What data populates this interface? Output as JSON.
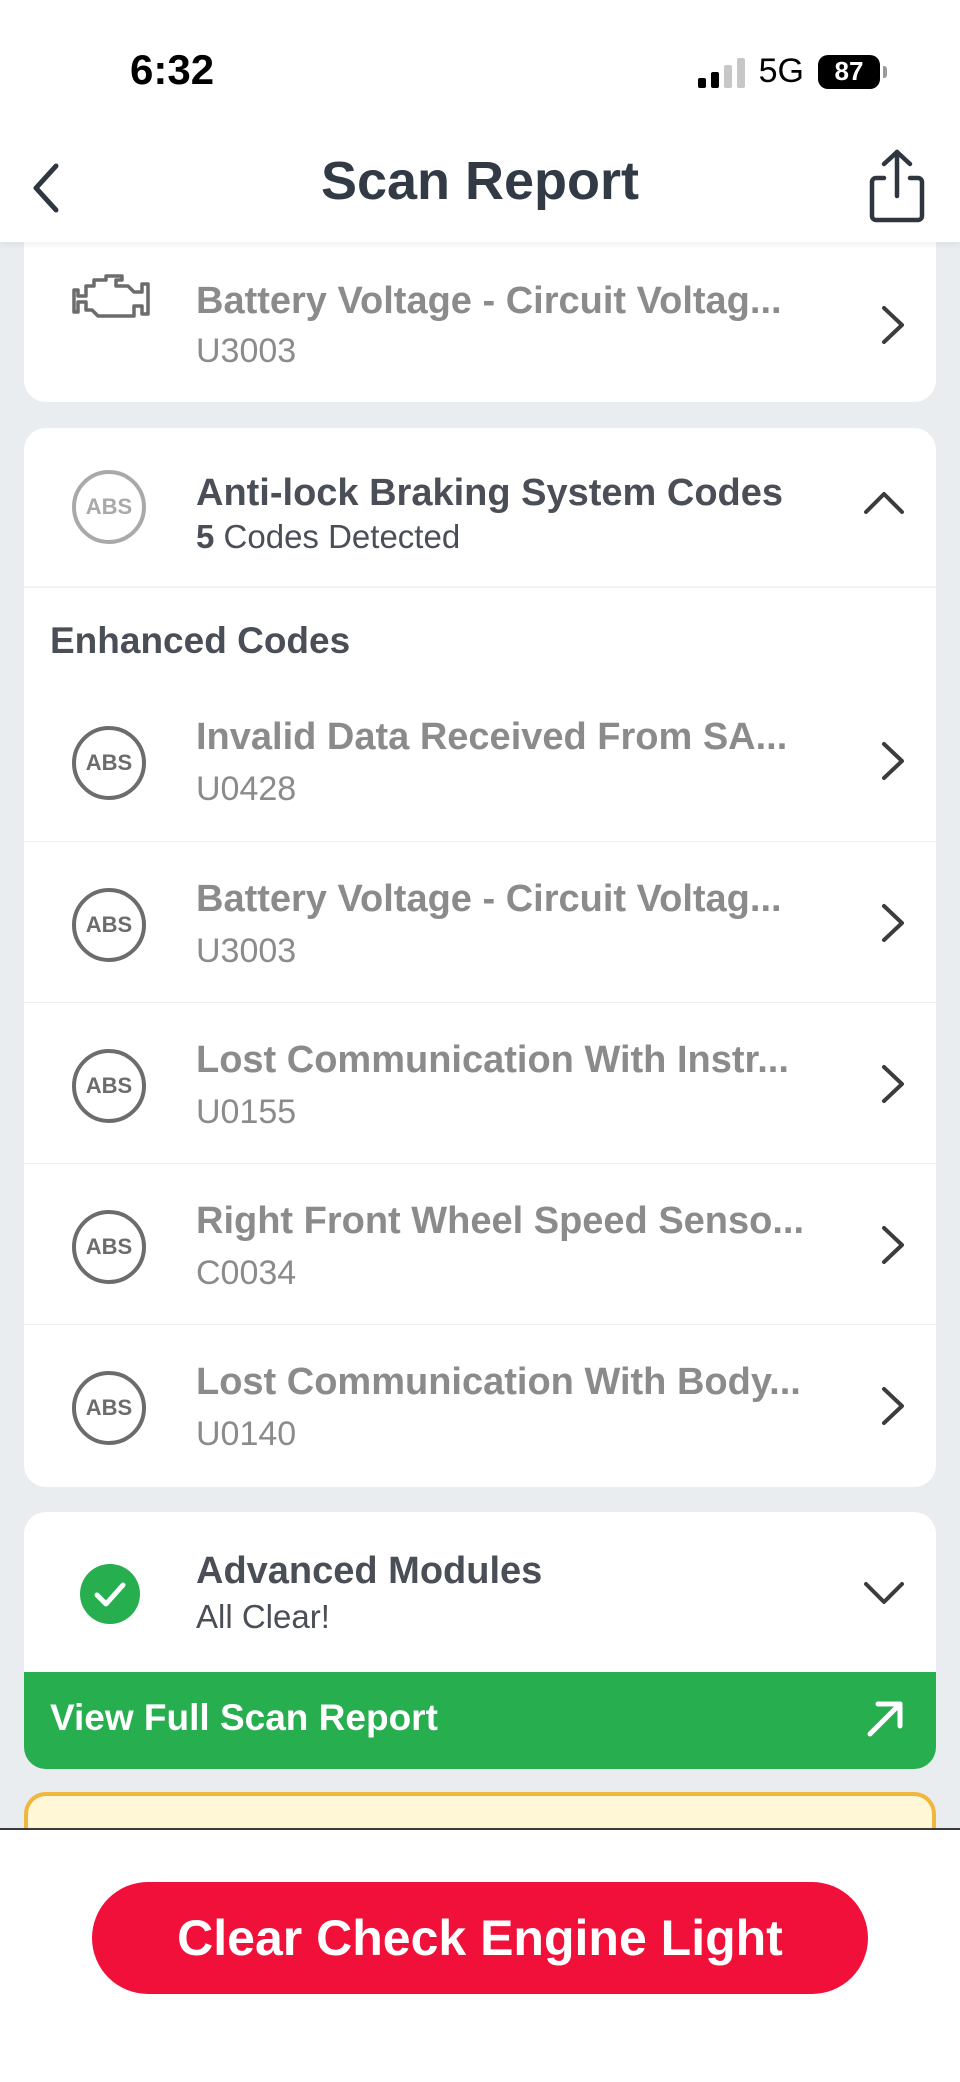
{
  "status_bar": {
    "time": "6:32",
    "network": "5G",
    "battery": "87"
  },
  "header": {
    "title": "Scan Report"
  },
  "engine_card": {
    "row": {
      "title": "Battery Voltage - Circuit Voltag...",
      "code": "U3003"
    }
  },
  "abs_card": {
    "title": "Anti-lock Braking System Codes",
    "count": "5",
    "count_suffix": "Codes Detected",
    "section_label": "Enhanced Codes",
    "badge_text": "ABS",
    "rows": [
      {
        "title": "Invalid Data Received From SA...",
        "code": "U0428"
      },
      {
        "title": "Battery Voltage - Circuit Voltag...",
        "code": "U3003"
      },
      {
        "title": "Lost Communication With Instr...",
        "code": "U0155"
      },
      {
        "title": "Right Front Wheel Speed Senso...",
        "code": "C0034"
      },
      {
        "title": "Lost Communication With Body...",
        "code": "U0140"
      }
    ]
  },
  "advanced_card": {
    "title": "Advanced Modules",
    "subtitle": "All Clear!"
  },
  "full_report_button": {
    "label": "View Full Scan Report"
  },
  "clear_button": {
    "label": "Clear Check Engine Light"
  },
  "colors": {
    "accent_green": "#27ae4f",
    "clear_red": "#f0103a",
    "warning_border": "#f0b63e"
  }
}
